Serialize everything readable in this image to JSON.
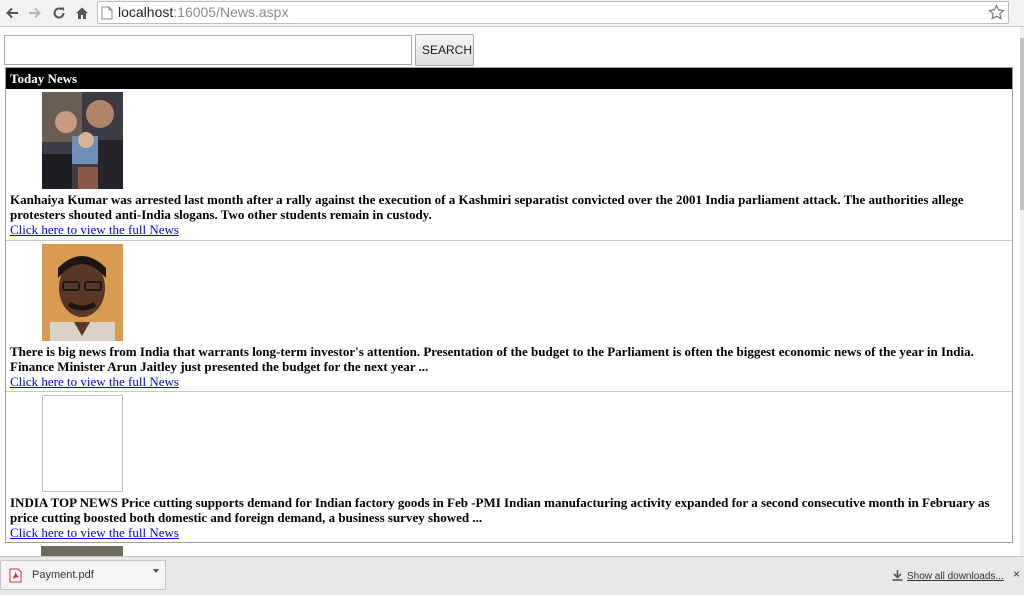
{
  "browser": {
    "url_host": "localhost",
    "url_rest": ":16005/News.aspx"
  },
  "search": {
    "value": "",
    "button_label": "SEARCH"
  },
  "news": {
    "header": "Today News",
    "items": [
      {
        "text": "Kanhaiya Kumar was arrested last month after a rally against the execution of a Kashmiri separatist convicted over the 2001 India parliament attack. The authorities allege protesters shouted anti-India slogans. Two other students remain in custody.",
        "link": "Click here to view the full News"
      },
      {
        "text": "There is big news from India that warrants long-term investor's attention. Presentation of the budget to the Parliament is often the biggest economic news of the year in India. Finance Minister Arun Jaitley just presented the budget for the next year ...",
        "link": "Click here to view the full News"
      },
      {
        "text": "INDIA TOP NEWS Price cutting supports demand for Indian factory goods in Feb -PMI Indian manufacturing activity expanded for a second consecutive month in February as price cutting boosted both domestic and foreign demand, a business survey showed ...",
        "link": "Click here to view the full News"
      }
    ]
  },
  "downloads": {
    "file_name": "Payment.pdf",
    "show_all": "Show all downloads...",
    "close": "×"
  }
}
